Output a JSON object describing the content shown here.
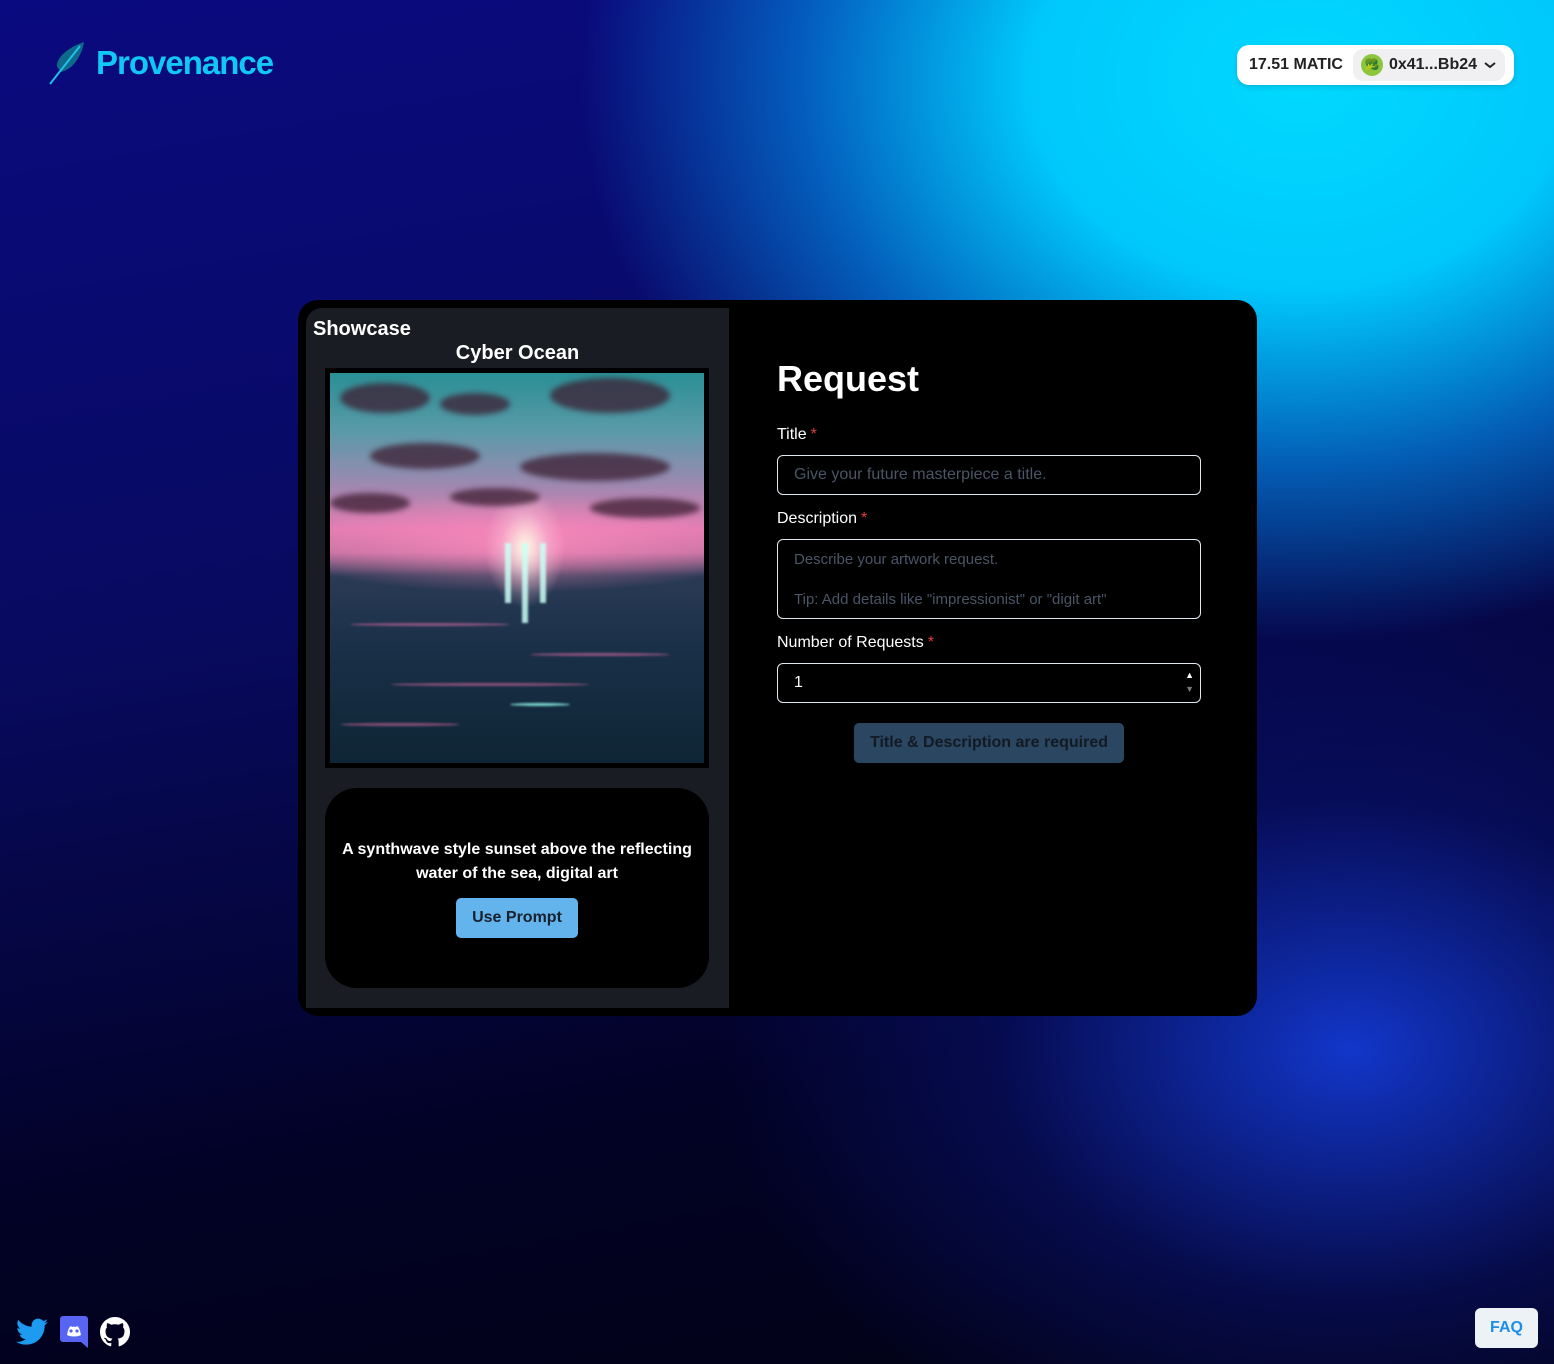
{
  "header": {
    "brand": "Provenance",
    "balance": "17.51 MATIC",
    "account": "0x41...Bb24",
    "avatar_emoji": "🥦"
  },
  "showcase": {
    "heading": "Showcase",
    "artwork_title": "Cyber Ocean",
    "prompt": "A synthwave style sunset above the reflecting water of the sea, digital art",
    "use_prompt_label": "Use Prompt"
  },
  "request": {
    "heading": "Request",
    "title_label": "Title",
    "title_placeholder": "Give your future masterpiece a title.",
    "description_label": "Description",
    "description_placeholder_1": "Describe your artwork request.",
    "description_placeholder_2": "Tip: Add details like \"impressionist\" or \"digit art\"",
    "count_label": "Number of Requests",
    "count_value": "1",
    "required_mark": "*",
    "submit_label": "Title & Description are required"
  },
  "footer": {
    "faq_label": "FAQ",
    "social": [
      "twitter",
      "discord",
      "github"
    ]
  },
  "colors": {
    "brand": "#10c8f5",
    "twitter": "#1d9bf0",
    "discord": "#5865f2",
    "button": "#63b3ed"
  }
}
